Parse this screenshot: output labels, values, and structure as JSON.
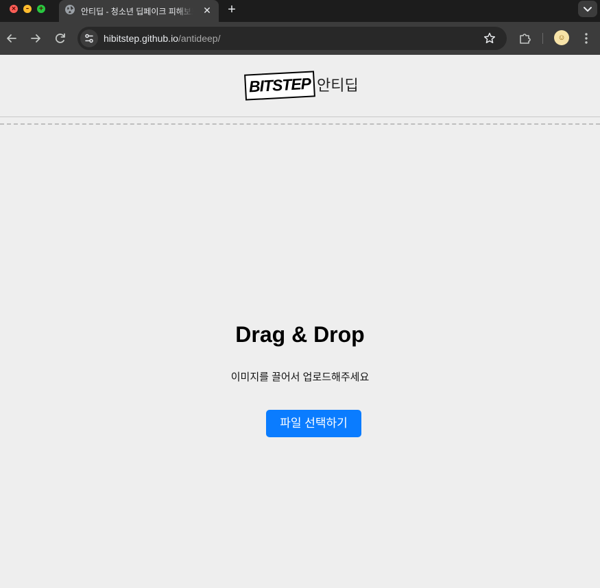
{
  "browser": {
    "tab": {
      "title": "안티딥 - 청소년 딥페이크 피해보호",
      "close_glyph": "✕",
      "favicon": "globe-icon"
    },
    "new_tab_glyph": "+",
    "tab_list_icon": "chevron-down-icon",
    "toolbar": {
      "back_icon": "arrow-left-icon",
      "forward_icon": "arrow-right-icon",
      "reload_icon": "reload-icon",
      "site_info_icon": "tune-icon",
      "url_host": "hibitstep.github.io",
      "url_path": "/antideep/",
      "bookmark_icon": "star-icon",
      "extensions_icon": "puzzle-icon",
      "profile_icon": "avatar-icon",
      "menu_icon": "kebab-icon"
    },
    "window_controls": {
      "close_glyph": "×",
      "minimize_glyph": "–",
      "maximize_glyph": "+"
    }
  },
  "header": {
    "logo_text": "BITSTEP",
    "site_name": "안티딥"
  },
  "dropzone": {
    "title": "Drag & Drop",
    "subtitle": "이미지를 끌어서 업로드해주세요",
    "button_label": "파일 선택하기"
  },
  "colors": {
    "page_background": "#eeeeee",
    "button": "#0a7cff",
    "chrome_dark": "#1c1c1c",
    "toolbar": "#3c3c3c"
  }
}
